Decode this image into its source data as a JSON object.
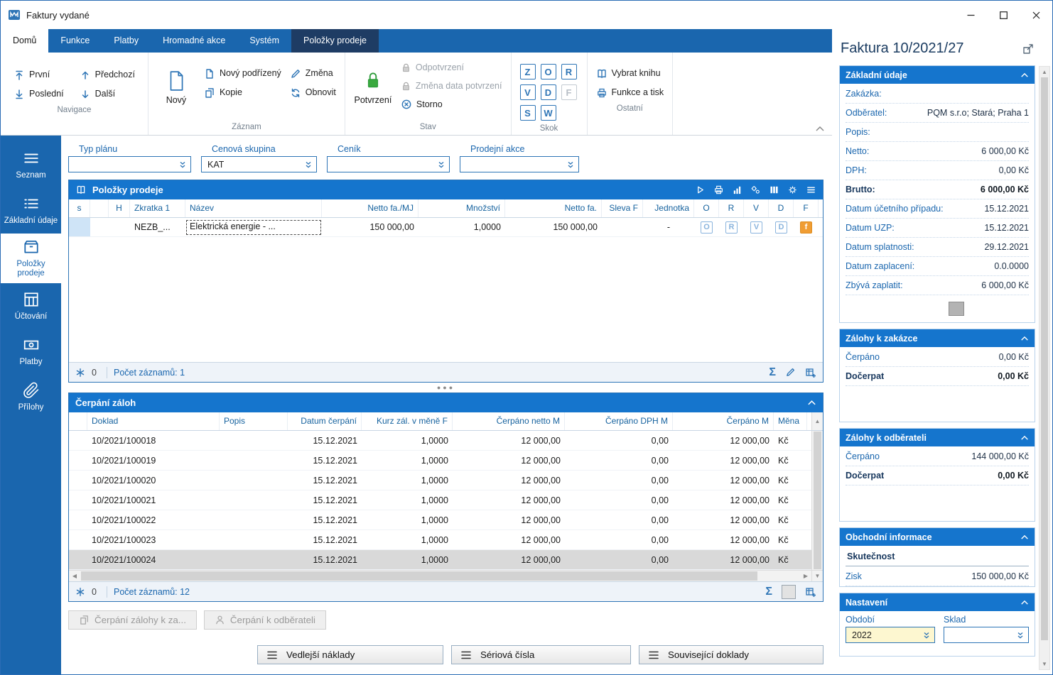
{
  "window": {
    "title": "Faktury vydané"
  },
  "theme": {
    "accent_blue": "#1a66ae",
    "panel_header_blue": "#1575cd",
    "active_tab_navy": "#1e3c64",
    "badge_orange": "#f09d33",
    "confirm_green": "#3aa93f",
    "selected_row_gray": "#d9d9d9"
  },
  "ribbon": {
    "tabs": [
      "Domů",
      "Funkce",
      "Platby",
      "Hromadné akce",
      "Systém",
      "Položky prodeje"
    ],
    "groups": {
      "navigace": {
        "label": "Navigace",
        "items": [
          "První",
          "Předchozí",
          "Poslední",
          "Další"
        ]
      },
      "zaznam": {
        "label": "Záznam",
        "big": "Nový",
        "items": [
          "Nový podřízený",
          "Kopie",
          "Změna",
          "Obnovit"
        ]
      },
      "stav": {
        "label": "Stav",
        "big": "Potvrzení",
        "items": [
          "Odpotvrzení",
          "Změna data potvrzení",
          "Storno"
        ]
      },
      "skok": {
        "label": "Skok",
        "letters": [
          "Z",
          "O",
          "R",
          "V",
          "D",
          "F",
          "S",
          "W"
        ]
      },
      "ostatni": {
        "label": "Ostatní",
        "items": [
          "Vybrat knihu",
          "Funkce a tisk"
        ]
      }
    }
  },
  "sidebar": {
    "items": [
      {
        "label": "Seznam"
      },
      {
        "label": "Základní údaje"
      },
      {
        "label": "Položky prodeje",
        "active": true
      },
      {
        "label": "Účtování"
      },
      {
        "label": "Platby"
      },
      {
        "label": "Přílohy"
      }
    ]
  },
  "filters": [
    {
      "label": "Typ plánu",
      "value": ""
    },
    {
      "label": "Cenová skupina",
      "value": "KAT"
    },
    {
      "label": "Ceník",
      "value": ""
    },
    {
      "label": "Prodejní akce",
      "value": ""
    }
  ],
  "polozky": {
    "title": "Položky prodeje",
    "columns": [
      "s",
      "",
      "H",
      "Zkratka 1",
      "Název",
      "Netto fa./MJ",
      "Množství",
      "Netto fa.",
      "Sleva F",
      "Jednotka",
      "O",
      "R",
      "V",
      "D",
      "F"
    ],
    "row": {
      "zkratka": "NEZB_...",
      "nazev": "Elektrická energie - ...",
      "netto_mj": "150 000,00",
      "mnozstvi": "1,0000",
      "netto_fa": "150 000,00",
      "sleva": "",
      "jednotka": "-",
      "flag_o": "O",
      "flag_r": "R",
      "flag_v": "V",
      "flag_d": "D",
      "flag_f": "f"
    },
    "status": {
      "counter": "0",
      "records": "Počet záznamů: 1"
    }
  },
  "cerpani": {
    "title": "Čerpání záloh",
    "columns": [
      "",
      "Doklad",
      "Popis",
      "Datum čerpání",
      "Kurz zál. v měně F",
      "Čerpáno netto M",
      "Čerpáno DPH M",
      "Čerpáno M",
      "Měna"
    ],
    "rows": [
      {
        "doklad": "10/2021/100018",
        "popis": "",
        "datum": "15.12.2021",
        "kurz": "1,0000",
        "netto": "12 000,00",
        "dph": "0,00",
        "cerpano": "12 000,00",
        "mena": "Kč"
      },
      {
        "doklad": "10/2021/100019",
        "popis": "",
        "datum": "15.12.2021",
        "kurz": "1,0000",
        "netto": "12 000,00",
        "dph": "0,00",
        "cerpano": "12 000,00",
        "mena": "Kč"
      },
      {
        "doklad": "10/2021/100020",
        "popis": "",
        "datum": "15.12.2021",
        "kurz": "1,0000",
        "netto": "12 000,00",
        "dph": "0,00",
        "cerpano": "12 000,00",
        "mena": "Kč"
      },
      {
        "doklad": "10/2021/100021",
        "popis": "",
        "datum": "15.12.2021",
        "kurz": "1,0000",
        "netto": "12 000,00",
        "dph": "0,00",
        "cerpano": "12 000,00",
        "mena": "Kč"
      },
      {
        "doklad": "10/2021/100022",
        "popis": "",
        "datum": "15.12.2021",
        "kurz": "1,0000",
        "netto": "12 000,00",
        "dph": "0,00",
        "cerpano": "12 000,00",
        "mena": "Kč"
      },
      {
        "doklad": "10/2021/100023",
        "popis": "",
        "datum": "15.12.2021",
        "kurz": "1,0000",
        "netto": "12 000,00",
        "dph": "0,00",
        "cerpano": "12 000,00",
        "mena": "Kč"
      },
      {
        "doklad": "10/2021/100024",
        "popis": "",
        "datum": "15.12.2021",
        "kurz": "1,0000",
        "netto": "12 000,00",
        "dph": "0,00",
        "cerpano": "12 000,00",
        "mena": "Kč",
        "selected": true
      }
    ],
    "status": {
      "counter": "0",
      "records": "Počet záznamů: 12"
    },
    "action_buttons": [
      "Čerpání zálohy k za...",
      "Čerpání k odběrateli"
    ]
  },
  "bottom_buttons": [
    "Vedlejší náklady",
    "Sériová čísla",
    "Související doklady"
  ],
  "detail": {
    "title": "Faktura 10/2021/27",
    "zakladni": {
      "title": "Základní údaje",
      "rows": [
        {
          "label": "Zakázka:",
          "value": ""
        },
        {
          "label": "Odběratel:",
          "value": "PQM s.r.o; Stará; Praha 1"
        },
        {
          "label": "Popis:",
          "value": ""
        },
        {
          "label": "Netto:",
          "value": "6 000,00 Kč"
        },
        {
          "label": "DPH:",
          "value": "0,00 Kč"
        },
        {
          "label": "Brutto:",
          "value": "6 000,00 Kč",
          "bold": true
        },
        {
          "label": "Datum účetního případu:",
          "value": "15.12.2021"
        },
        {
          "label": "Datum UZP:",
          "value": "15.12.2021"
        },
        {
          "label": "Datum splatnosti:",
          "value": "29.12.2021"
        },
        {
          "label": "Datum zaplacení:",
          "value": "0.0.0000"
        },
        {
          "label": "Zbývá zaplatit:",
          "value": "6 000,00 Kč"
        }
      ]
    },
    "zalohy_zakazka": {
      "title": "Zálohy k zakázce",
      "rows": [
        {
          "label": "Čerpáno",
          "value": "0,00 Kč"
        },
        {
          "label": "Dočerpat",
          "value": "0,00 Kč",
          "bold": true
        }
      ]
    },
    "zalohy_odberatel": {
      "title": "Zálohy k odběrateli",
      "rows": [
        {
          "label": "Čerpáno",
          "value": "144 000,00 Kč"
        },
        {
          "label": "Dočerpat",
          "value": "0,00 Kč",
          "bold": true
        }
      ]
    },
    "obchodni": {
      "title": "Obchodní informace",
      "tab": "Skutečnost",
      "rows": [
        {
          "label": "Zisk",
          "value": "150 000,00 Kč"
        }
      ]
    },
    "nastaveni": {
      "title": "Nastavení",
      "fields": [
        {
          "label": "Období",
          "value": "2022"
        },
        {
          "label": "Sklad",
          "value": ""
        }
      ]
    }
  }
}
